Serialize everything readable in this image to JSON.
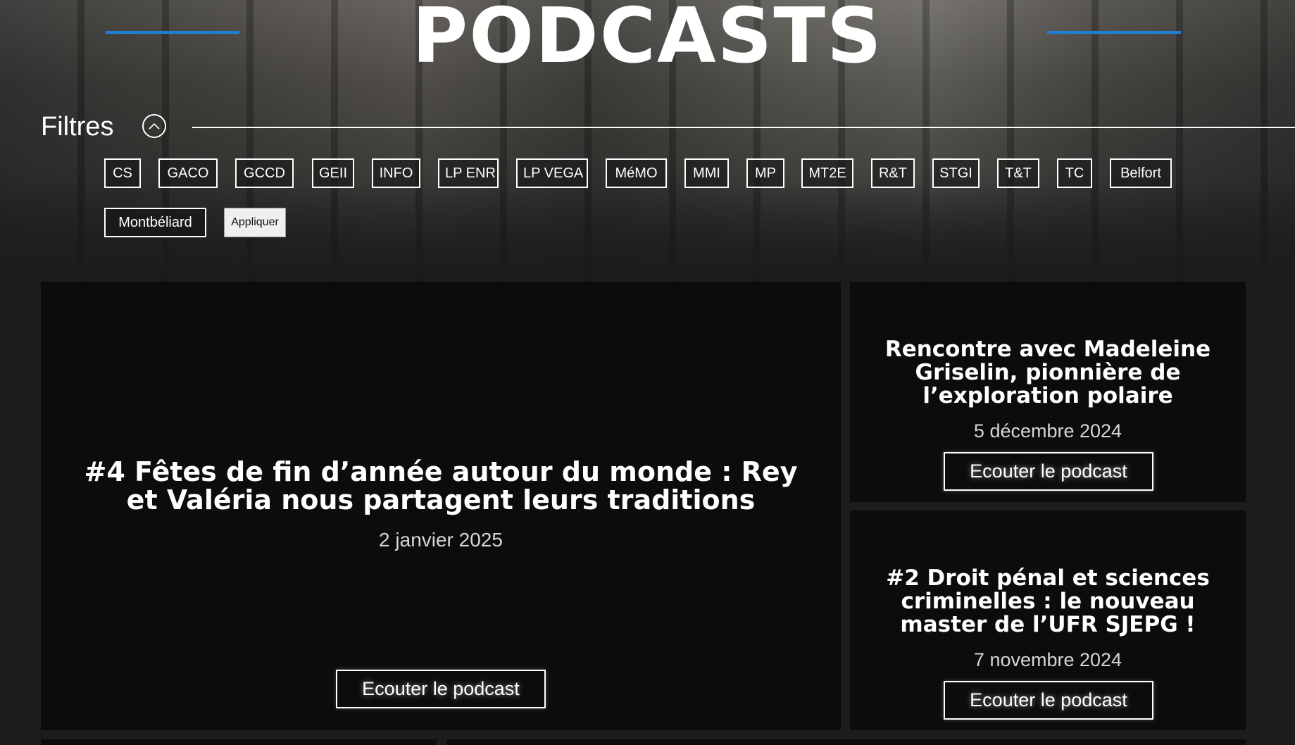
{
  "header": {
    "title": "PODCASTS",
    "accent_color": "#1f7fd6"
  },
  "filters": {
    "label": "Filtres",
    "toggle_icon": "chevron-up-icon",
    "chips": [
      "CS",
      "GACO",
      "GCCD",
      "GEII",
      "INFO",
      "LP ENR",
      "LP VEGA",
      "MéMO",
      "MMI",
      "MP",
      "MT2E",
      "R&T",
      "STGI",
      "T&T",
      "TC",
      "Belfort",
      "Montbéliard"
    ],
    "apply_label": "Appliquer"
  },
  "podcasts": [
    {
      "title": "#4 Fêtes de fin d’année autour du monde : Rey et Valéria nous partagent leurs traditions",
      "date": "2 janvier 2025",
      "button_label": "Ecouter le podcast"
    },
    {
      "title": "Rencontre avec Madeleine Griselin, pionnière de l’exploration polaire",
      "date": "5 décembre 2024",
      "button_label": "Ecouter le podcast"
    },
    {
      "title": "#2 Droit pénal et sciences criminelles : le nouveau master de l’UFR SJEPG !",
      "date": "7 novembre 2024",
      "button_label": "Ecouter le podcast"
    }
  ]
}
